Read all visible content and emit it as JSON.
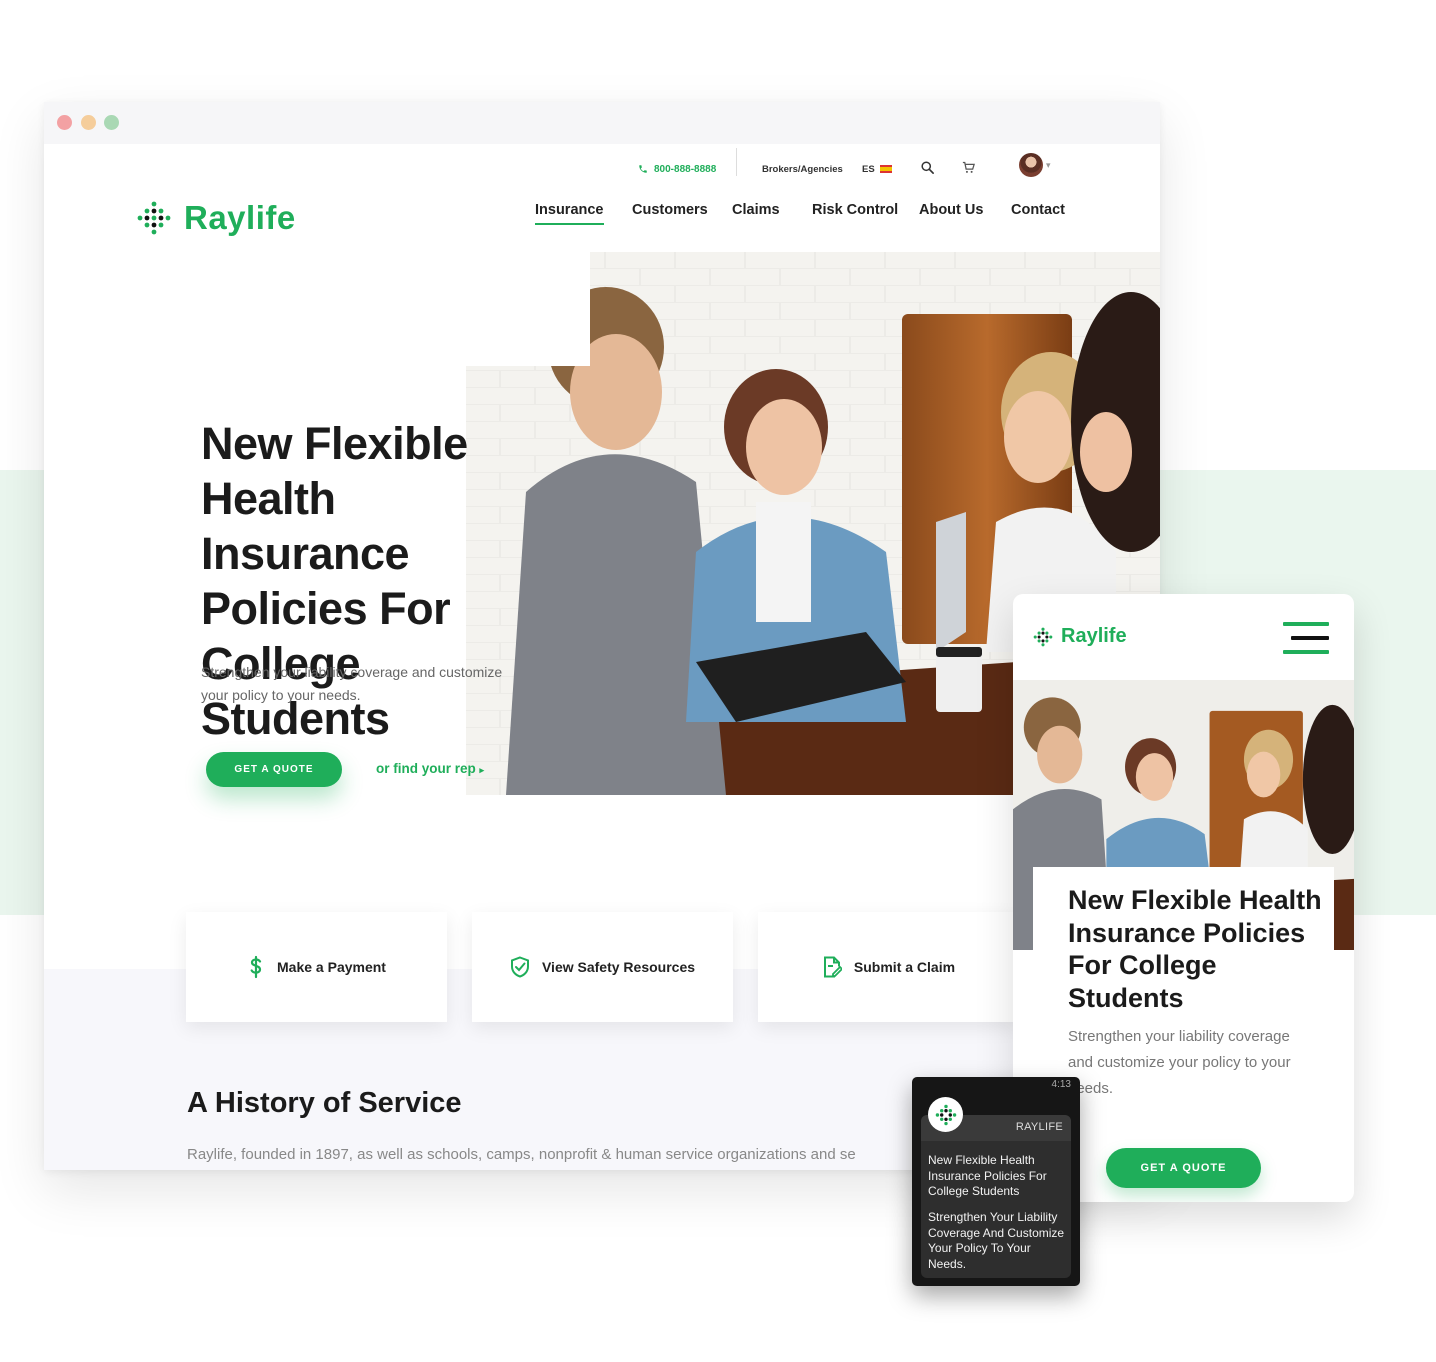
{
  "brand": {
    "name": "Raylife",
    "accent_color": "#1fae5a",
    "logo_icon": "raylife-dots-logo-icon"
  },
  "utility_bar": {
    "phone": "800-888-8888",
    "brokers": "Brokers/Agencies",
    "language": "ES",
    "search_icon": "search-icon",
    "cart_icon": "cart-icon",
    "avatar": "user-avatar"
  },
  "nav": {
    "items": [
      "Insurance",
      "Customers",
      "Claims",
      "Risk Control",
      "About Us",
      "Contact"
    ],
    "active": "Insurance"
  },
  "hero": {
    "title": "New Flexible Health Insurance Policies For College Students",
    "subtitle": "Strengthen your liability coverage and customize your policy to your needs.",
    "cta": "GET A QUOTE",
    "secondary_link": "or find your rep",
    "image": "students-at-table-photo"
  },
  "cards": [
    {
      "label": "Make a Payment",
      "icon": "dollar-icon"
    },
    {
      "label": "View Safety Resources",
      "icon": "shield-icon"
    },
    {
      "label": "Submit a Claim",
      "icon": "document-edit-icon"
    }
  ],
  "history": {
    "title": "A History of Service",
    "text": "Raylife, founded in 1897,  as well as schools, camps, nonprofit & human service organizations and se"
  },
  "mobile": {
    "logo": "Raylife",
    "menu_icon": "hamburger-menu-icon",
    "title": "New Flexible Health Insurance Policies For College Students",
    "subtitle": "Strengthen your liability coverage and customize your policy to your needs.",
    "cta": "GET A QUOTE"
  },
  "watch": {
    "time": "4:13",
    "app_name": "RAYLIFE",
    "title": "New Flexible Health Insurance Policies For College Students",
    "message": "Strengthen Your Liability Coverage And Customize Your Policy To Your Needs."
  }
}
